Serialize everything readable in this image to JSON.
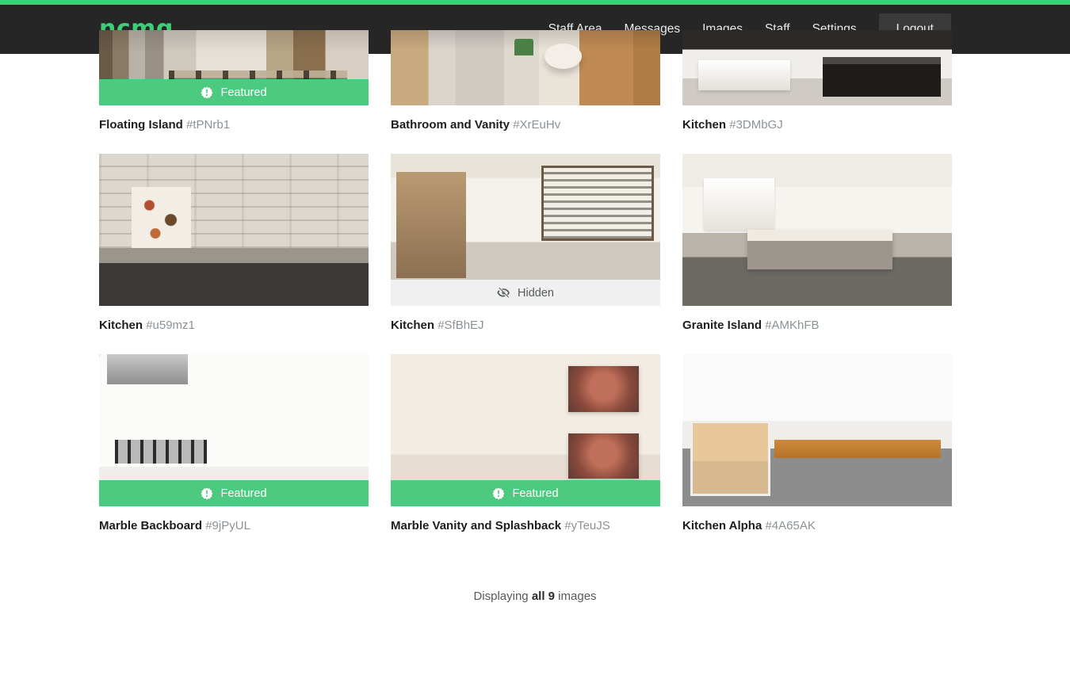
{
  "theme": {
    "accent_green": "#3ece78",
    "navbar_bg": "#262626",
    "featured_green": "#4ccb80",
    "hidden_gray": "#f0f0f0",
    "hash_gray": "#8b9296"
  },
  "navbar": {
    "brand": "ncmg",
    "links": [
      {
        "label": "Staff Area"
      },
      {
        "label": "Messages"
      },
      {
        "label": "Images"
      },
      {
        "label": "Staff"
      },
      {
        "label": "Settings"
      }
    ],
    "logout_label": "Logout"
  },
  "badges": {
    "featured_label": "Featured",
    "featured_icon": "certificate-exclamation-icon",
    "hidden_label": "Hidden",
    "hidden_icon": "eye-slash-icon"
  },
  "gallery": {
    "images": [
      {
        "title": "Floating Island",
        "hash": "#tPNrb1",
        "badge": "featured",
        "art": "ph-island",
        "clipped": true
      },
      {
        "title": "Bathroom and Vanity",
        "hash": "#XrEuHv",
        "badge": "none",
        "art": "ph-bath",
        "clipped": true
      },
      {
        "title": "Kitchen",
        "hash": "#3DMbGJ",
        "badge": "none",
        "art": "ph-darkkitchen",
        "clipped": true
      },
      {
        "title": "Kitchen",
        "hash": "#u59mz1",
        "badge": "none",
        "art": "ph-rustic",
        "clipped": false
      },
      {
        "title": "Kitchen",
        "hash": "#SfBhEJ",
        "badge": "hidden",
        "art": "ph-bright",
        "clipped": false
      },
      {
        "title": "Granite Island",
        "hash": "#AMKhFB",
        "badge": "none",
        "art": "ph-granite",
        "clipped": false
      },
      {
        "title": "Marble Backboard",
        "hash": "#9jPyUL",
        "badge": "featured",
        "art": "ph-marble",
        "clipped": false
      },
      {
        "title": "Marble Vanity and Splashback",
        "hash": "#yTeuJS",
        "badge": "featured",
        "art": "ph-vanity",
        "clipped": false
      },
      {
        "title": "Kitchen Alpha",
        "hash": "#4A65AK",
        "badge": "none",
        "art": "ph-alpha",
        "clipped": false
      }
    ]
  },
  "footer": {
    "status_prefix": "Displaying ",
    "status_count": "all 9",
    "status_suffix": " images"
  }
}
